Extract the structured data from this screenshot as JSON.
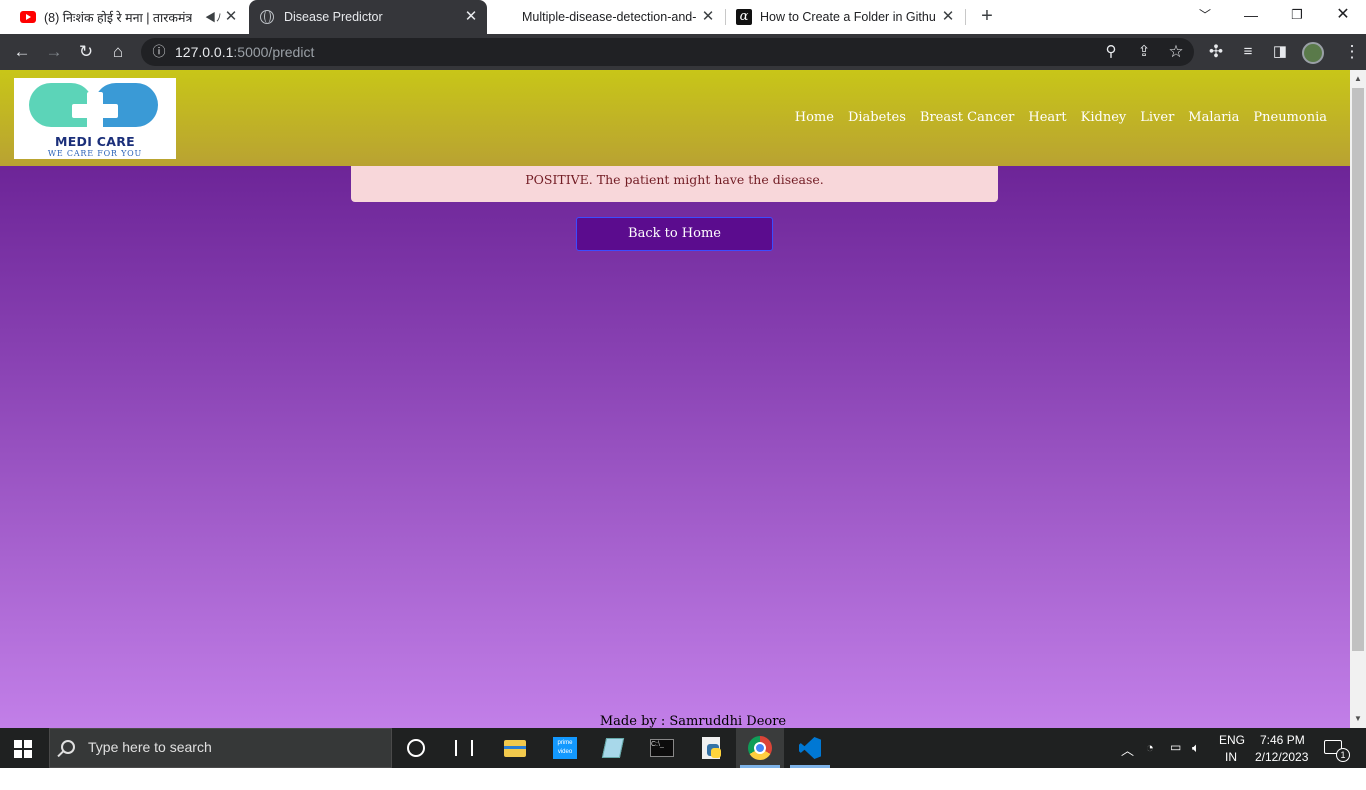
{
  "browser": {
    "tabs": [
      {
        "title": "(8) निःशंक होई रे मना | तारकमंत्र",
        "favicon": "youtube-icon",
        "audio": true,
        "active": false
      },
      {
        "title": "Disease Predictor",
        "favicon": "globe-icon",
        "active": true
      },
      {
        "title": "Multiple-disease-detection-and-p",
        "favicon": "none",
        "active": false
      },
      {
        "title": "How to Create a Folder in Github",
        "favicon": "alpha-icon",
        "active": false
      }
    ],
    "url_host": "127.0.0.1",
    "url_path": ":5000/predict"
  },
  "site": {
    "logo": {
      "brand": "MEDI CARE",
      "tagline": "WE CARE FOR YOU"
    },
    "nav": [
      "Home",
      "Diabetes",
      "Breast Cancer",
      "Heart",
      "Kidney",
      "Liver",
      "Malaria",
      "Pneumonia"
    ],
    "result_message": "POSITIVE. The patient might have the disease.",
    "back_button": "Back to Home",
    "footer": "Made by : Samruddhi Deore",
    "colors": {
      "navbar": "#c8c618",
      "page_top": "#5f168a",
      "page_bottom": "#c27fe8",
      "alert_bg": "#f8d7da",
      "alert_text": "#721c24",
      "button": "#5b0c8e"
    }
  },
  "taskbar": {
    "search_placeholder": "Type here to search",
    "language": "ENG",
    "region": "IN",
    "time": "7:46 PM",
    "date": "2/12/2023",
    "notification_count": "1"
  }
}
